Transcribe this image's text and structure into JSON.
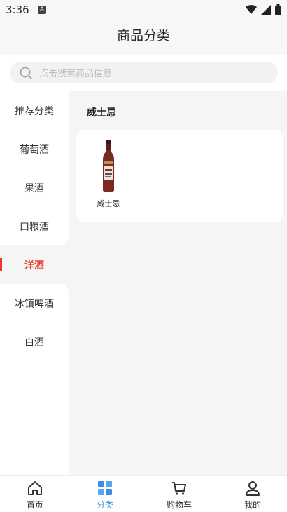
{
  "status_bar": {
    "time": "3:36",
    "notification_badge": "A"
  },
  "header": {
    "title": "商品分类"
  },
  "search": {
    "placeholder": "点击搜索商品信息"
  },
  "sidebar": {
    "items": [
      {
        "label": "推荐分类"
      },
      {
        "label": "葡萄酒"
      },
      {
        "label": "果酒"
      },
      {
        "label": "口粮酒"
      },
      {
        "label": "洋酒",
        "active": true
      },
      {
        "label": "冰镇啤酒"
      },
      {
        "label": "白酒"
      }
    ]
  },
  "content": {
    "section_title": "威士忌",
    "products": [
      {
        "name": "威士忌",
        "icon": "whisky-bottle-image"
      }
    ]
  },
  "tabbar": {
    "items": [
      {
        "label": "首页",
        "icon": "home-icon"
      },
      {
        "label": "分类",
        "icon": "category-grid-icon",
        "active": true
      },
      {
        "label": "购物车",
        "icon": "cart-icon"
      },
      {
        "label": "我的",
        "icon": "user-icon"
      }
    ]
  },
  "colors": {
    "accent_red": "#e8392c",
    "accent_blue": "#3a8ee6"
  }
}
